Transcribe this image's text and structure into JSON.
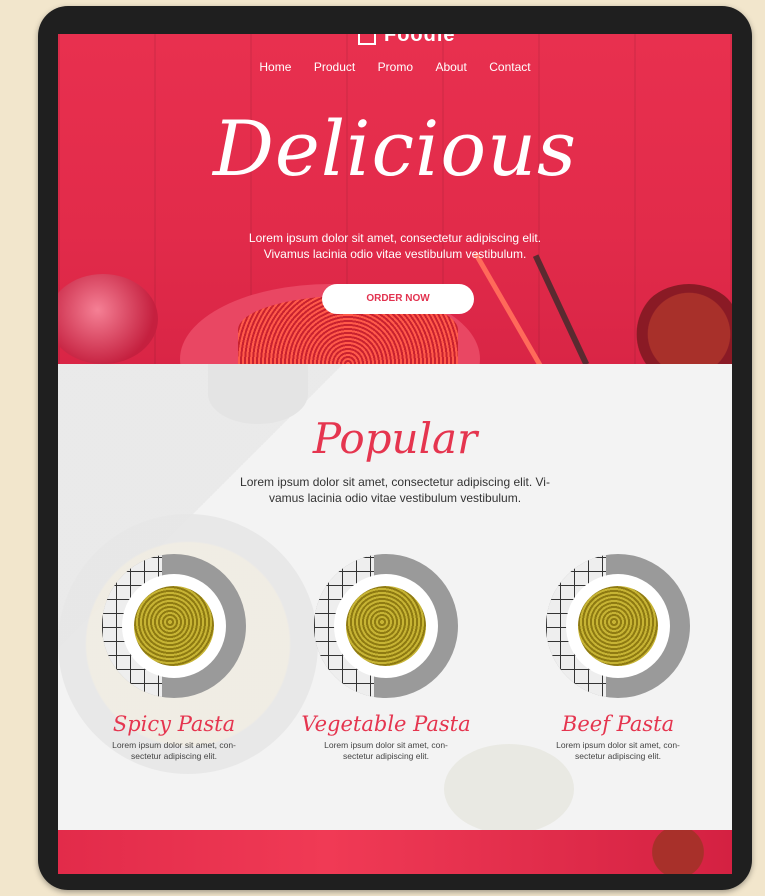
{
  "brand": {
    "logo_text": "Foodie"
  },
  "nav": [
    "Home",
    "Product",
    "Promo",
    "About",
    "Contact"
  ],
  "hero": {
    "title": "Delicious",
    "line1": "Lorem ipsum dolor sit amet, consectetur adipiscing elit.",
    "line2": "Vivamus lacinia odio vitae vestibulum vestibulum.",
    "button": "ORDER NOW"
  },
  "popular": {
    "title": "Popular",
    "line1": "Lorem ipsum dolor sit amet, consectetur adipiscing elit. Vi-",
    "line2": "vamus lacinia odio vitae vestibulum vestibulum.",
    "items": [
      {
        "name": "Spicy Pasta",
        "desc1": "Lorem ipsum dolor sit amet, con-",
        "desc2": "sectetur adipiscing elit."
      },
      {
        "name": "Vegetable Pasta",
        "desc1": "Lorem ipsum dolor sit amet, con-",
        "desc2": "sectetur adipiscing elit."
      },
      {
        "name": "Beef Pasta",
        "desc1": "Lorem ipsum dolor sit amet, con-",
        "desc2": "sectetur adipiscing elit."
      }
    ]
  },
  "colors": {
    "accent": "#e5354f",
    "hero_bg": "#e22b4a",
    "device": "#1f1f1f",
    "page_bg": "#f2e6cc"
  }
}
